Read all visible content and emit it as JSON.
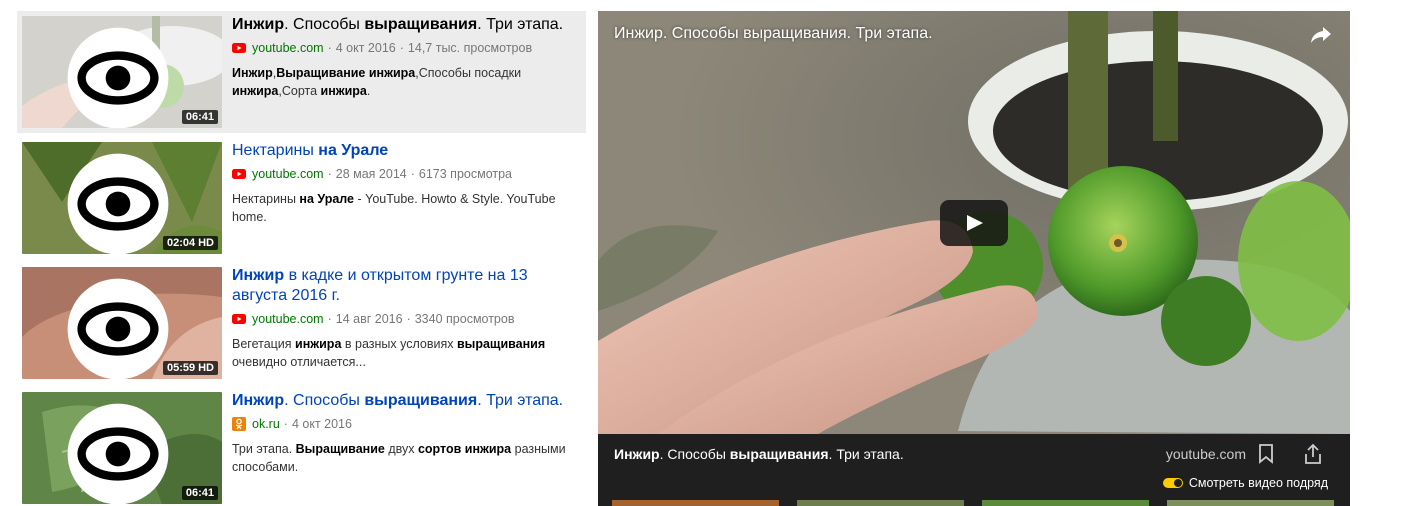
{
  "results": [
    {
      "title": [
        {
          "t": "Инжир",
          "b": true
        },
        {
          "t": ". Способы ",
          "b": false
        },
        {
          "t": "выращивания",
          "b": true
        },
        {
          "t": ". Три этапа.",
          "b": false
        }
      ],
      "source": "youtube",
      "host": "youtube.com",
      "date": "4 окт 2016",
      "views": "14,7 тыс. просмотров",
      "description": [
        {
          "t": "Инжир",
          "b": true
        },
        {
          "t": ",",
          "b": false
        },
        {
          "t": "Выращивание инжира",
          "b": true
        },
        {
          "t": ",Способы посадки ",
          "b": false
        },
        {
          "t": "инжира",
          "b": true
        },
        {
          "t": ",Сорта ",
          "b": false
        },
        {
          "t": "инжира",
          "b": true
        },
        {
          "t": ".",
          "b": false
        }
      ],
      "duration": "06:41",
      "hd": "",
      "active": true,
      "thumb": "fig"
    },
    {
      "title": [
        {
          "t": "Нектарины ",
          "b": false
        },
        {
          "t": "на Урале",
          "b": true
        }
      ],
      "source": "youtube",
      "host": "youtube.com",
      "date": "28 мая 2014",
      "views": "6173 просмотра",
      "description": [
        {
          "t": "Нектарины ",
          "b": false
        },
        {
          "t": "на Урале",
          "b": true
        },
        {
          "t": " - YouTube. Howto & Style. YouTube home.",
          "b": false
        }
      ],
      "duration": "02:04",
      "hd": "HD",
      "active": false,
      "thumb": "nectarine"
    },
    {
      "title": [
        {
          "t": "Инжир",
          "b": true
        },
        {
          "t": " в кадке и открытом грунте на 13 августа 2016 г.",
          "b": false
        }
      ],
      "source": "youtube",
      "host": "youtube.com",
      "date": "14 авг 2016",
      "views": "3340 просмотров",
      "description": [
        {
          "t": "Вегетация ",
          "b": false
        },
        {
          "t": "инжира",
          "b": true
        },
        {
          "t": " в разных условиях ",
          "b": false
        },
        {
          "t": "выращивания",
          "b": true
        },
        {
          "t": " очевидно отличается...",
          "b": false
        }
      ],
      "duration": "05:59",
      "hd": "HD",
      "active": false,
      "thumb": "hand"
    },
    {
      "title": [
        {
          "t": "Инжир",
          "b": true
        },
        {
          "t": ". Способы ",
          "b": false
        },
        {
          "t": "выращивания",
          "b": true
        },
        {
          "t": ". Три этапа.",
          "b": false
        }
      ],
      "source": "ok",
      "host": "ok.ru",
      "date": "4 окт 2016",
      "views": "",
      "description": [
        {
          "t": "Три этапа. ",
          "b": false
        },
        {
          "t": "Выращивание",
          "b": true
        },
        {
          "t": " двух ",
          "b": false
        },
        {
          "t": "сортов инжира",
          "b": true
        },
        {
          "t": " разными способами.",
          "b": false
        }
      ],
      "duration": "06:41",
      "hd": "",
      "active": false,
      "thumb": "leaves"
    }
  ],
  "player": {
    "video_title": "Инжир. Способы выращивания. Три этапа.",
    "bar_title": [
      {
        "t": "Инжир",
        "b": true
      },
      {
        "t": ". Способы ",
        "b": false
      },
      {
        "t": "выращивания",
        "b": true
      },
      {
        "t": ". Три этапа.",
        "b": false
      }
    ],
    "host": "youtube.com",
    "autoplay_label": "Смотреть видео подряд",
    "autoplay_on": true
  },
  "colors": {
    "link": "#0044bb",
    "host": "#007700",
    "youtube": "#ff0000",
    "ok": "#ee8208",
    "toggle": "#ffcc00"
  }
}
